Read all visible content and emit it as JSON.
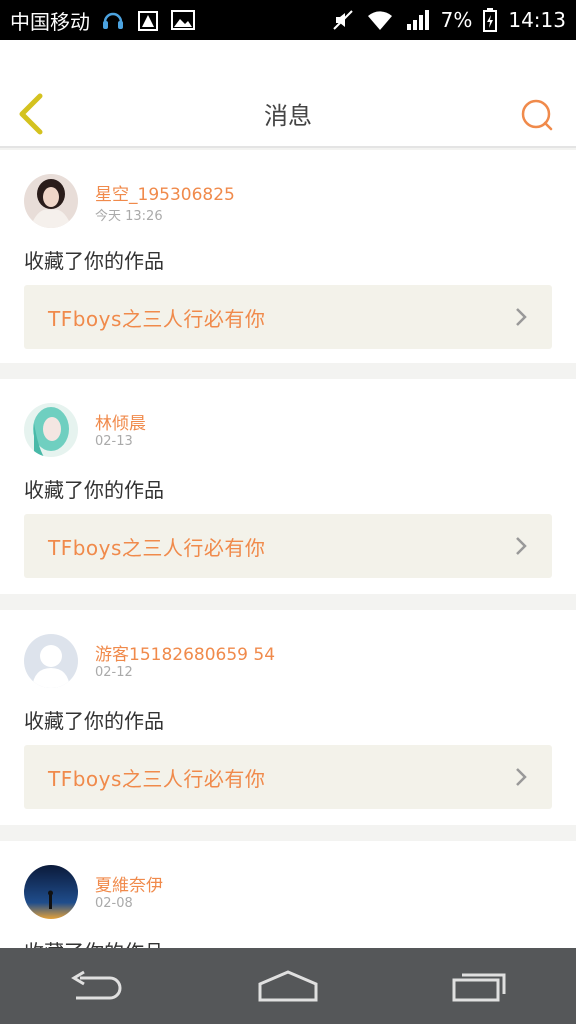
{
  "status_bar": {
    "carrier": "中国移动",
    "battery": "7%",
    "time": "14:13"
  },
  "header": {
    "title": "消息"
  },
  "messages": [
    {
      "user": "星空_195306825",
      "date": "今天 13:26",
      "text": "收藏了你的作品",
      "work": "TFboys之三人行必有你"
    },
    {
      "user": "林倾晨",
      "date": "02-13",
      "text": "收藏了你的作品",
      "work": "TFboys之三人行必有你"
    },
    {
      "user": "游客15182680659 54",
      "date": "02-12",
      "text": "收藏了你的作品",
      "work": "TFboys之三人行必有你"
    },
    {
      "user": "夏維奈伊",
      "date": "02-08",
      "text": "收藏了你的作品",
      "work": ""
    }
  ],
  "colors": {
    "accent": "#f08a4b",
    "back_arrow": "#d4c21f",
    "work_bg": "#f3f2ea"
  }
}
